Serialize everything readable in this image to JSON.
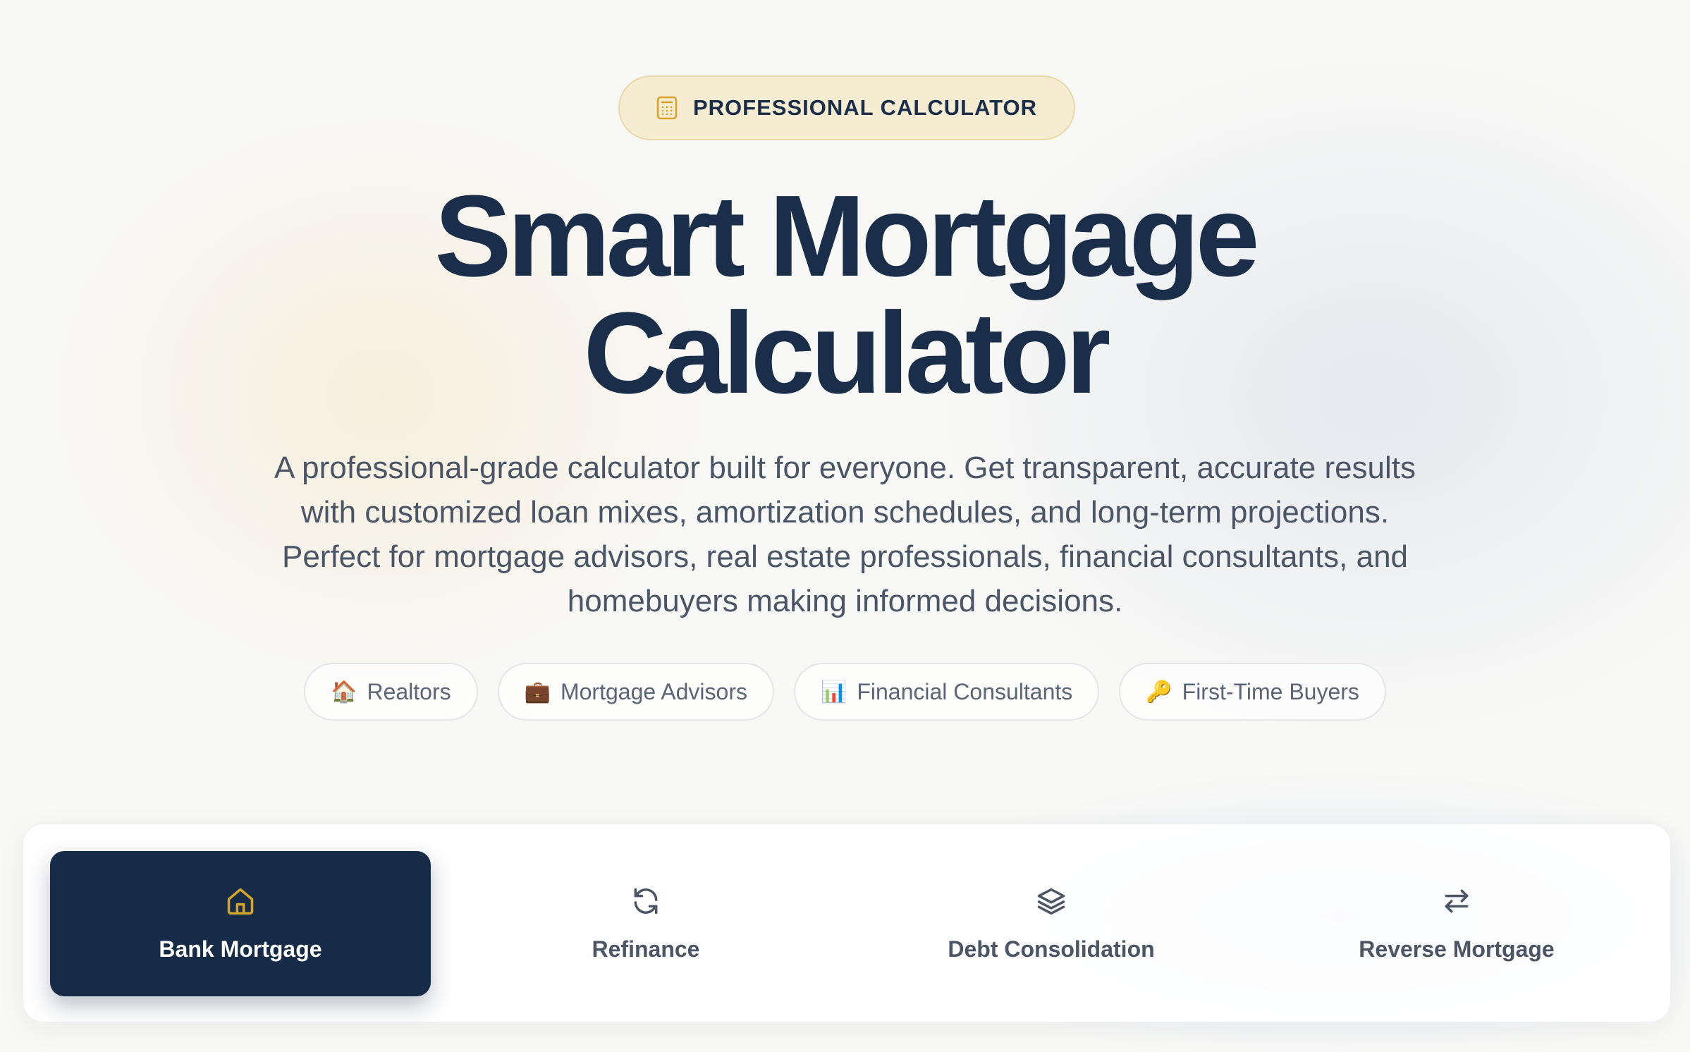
{
  "badge": {
    "icon": "calculator-icon",
    "text": "PROFESSIONAL CALCULATOR"
  },
  "hero": {
    "title_line1": "Smart Mortgage",
    "title_line2": "Calculator",
    "subtitle": "A professional-grade calculator built for everyone. Get transparent, accurate results with customized loan mixes, amortization schedules, and long-term projections. Perfect for mortgage advisors, real estate professionals, financial consultants, and homebuyers making informed decisions."
  },
  "audiences": [
    {
      "emoji": "🏠",
      "label": "Realtors"
    },
    {
      "emoji": "💼",
      "label": "Mortgage Advisors"
    },
    {
      "emoji": "📊",
      "label": "Financial Consultants"
    },
    {
      "emoji": "🔑",
      "label": "First-Time Buyers"
    }
  ],
  "tabs": [
    {
      "label": "Bank Mortgage",
      "icon": "home-icon",
      "active": true
    },
    {
      "label": "Refinance",
      "icon": "refresh-icon",
      "active": false
    },
    {
      "label": "Debt Consolidation",
      "icon": "layers-icon",
      "active": false
    },
    {
      "label": "Reverse Mortgage",
      "icon": "swap-arrows-icon",
      "active": false
    }
  ],
  "colors": {
    "navy": "#1a2e4a",
    "active_tab": "#162b48",
    "gold": "#d4a52a",
    "badge_bg": "#f6ecd2",
    "muted_text": "#4b5565"
  }
}
